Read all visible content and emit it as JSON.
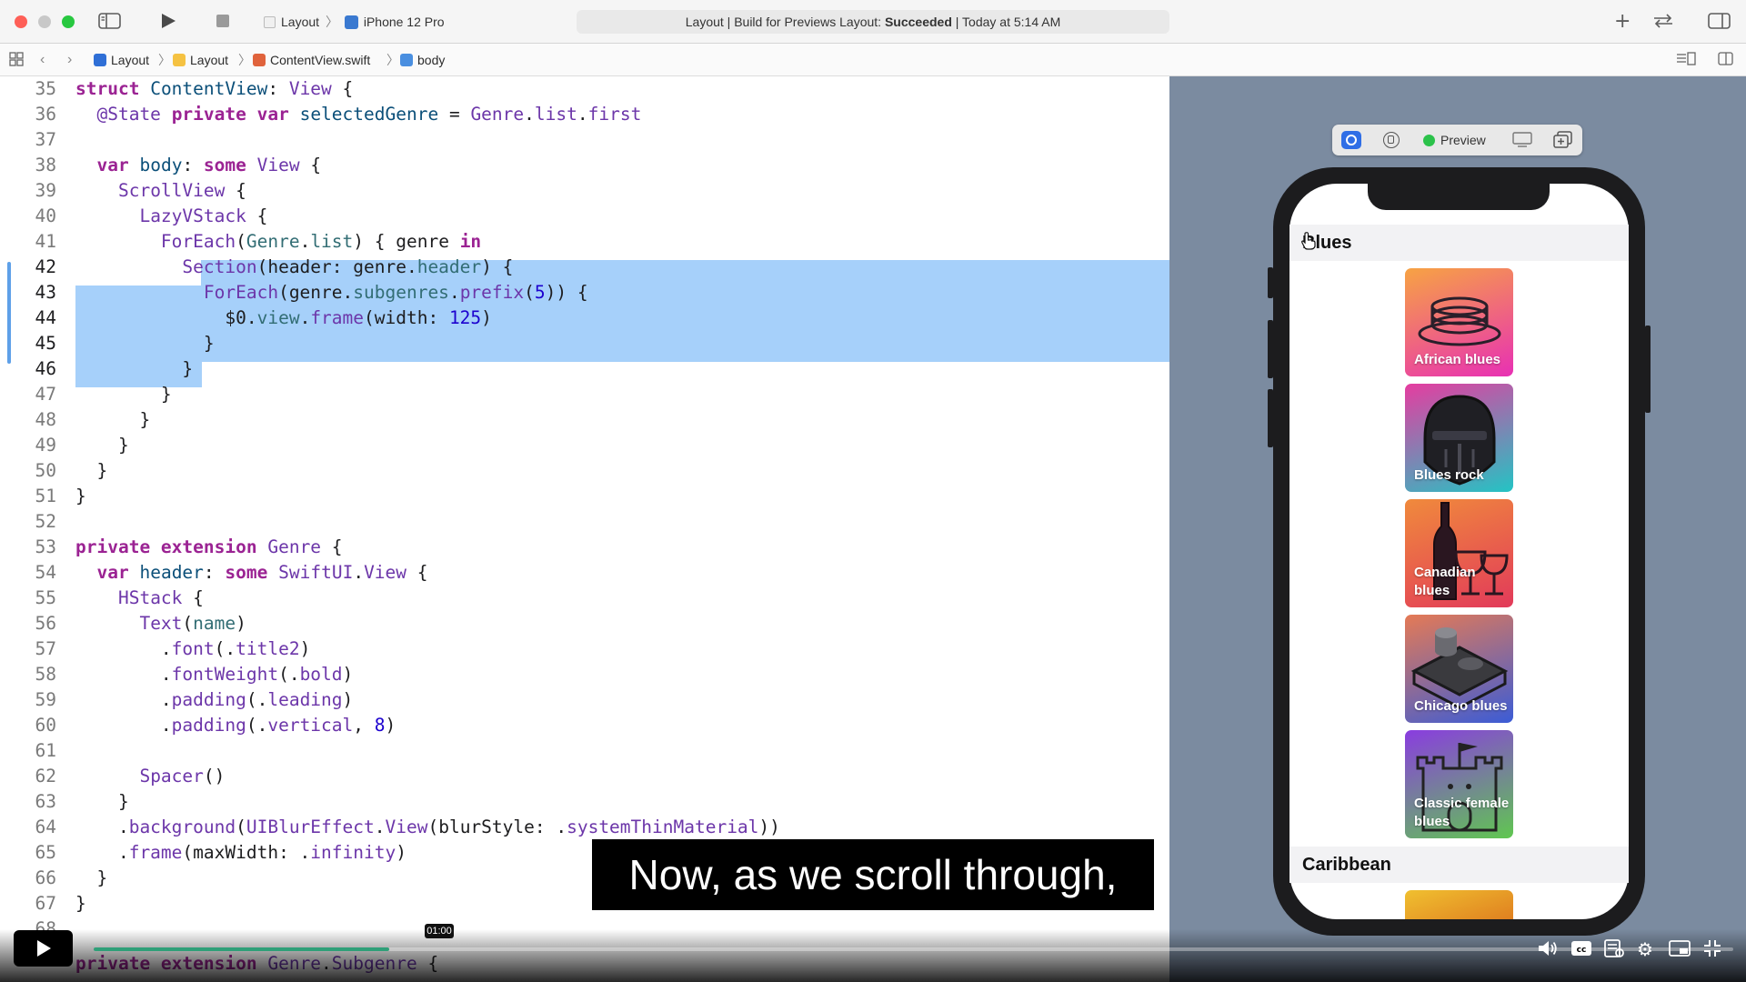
{
  "toolbar": {
    "scheme_project": "Layout",
    "scheme_device": "iPhone 12 Pro",
    "status_prefix": "Layout | Build for Previews Layout: ",
    "status_result": "Succeeded",
    "status_suffix": " | Today at 5:14 AM"
  },
  "jumpbar": {
    "items": [
      "Layout",
      "Layout",
      "ContentView.swift",
      "body"
    ]
  },
  "editor": {
    "line_numbers": [
      "35",
      "36",
      "37",
      "38",
      "39",
      "40",
      "41",
      "42",
      "43",
      "44",
      "45",
      "46",
      "47",
      "48",
      "49",
      "50",
      "51",
      "52",
      "53",
      "54",
      "55",
      "56",
      "57",
      "58",
      "59",
      "60",
      "61",
      "62",
      "63",
      "64",
      "65",
      "66",
      "67",
      "68"
    ]
  },
  "preview": {
    "toolbar_label": "Preview",
    "sections": [
      {
        "header": "Blues",
        "tiles": [
          {
            "label": "African blues",
            "gradient": [
              "#f7a343",
              "#e830b4"
            ]
          },
          {
            "label": "Blues rock",
            "gradient": [
              "#e63ca0",
              "#23c4c4"
            ]
          },
          {
            "label": "Canadian blues",
            "gradient": [
              "#f08a3c",
              "#e23a5a"
            ]
          },
          {
            "label": "Chicago blues",
            "gradient": [
              "#e57a55",
              "#3b5cd6"
            ]
          },
          {
            "label": "Classic female blues",
            "gradient": [
              "#8a3ce0",
              "#60c750"
            ]
          }
        ]
      },
      {
        "header": "Caribbean",
        "tiles": [
          {
            "label": "",
            "gradient": [
              "#f0c030",
              "#e08020"
            ]
          }
        ]
      }
    ]
  },
  "video": {
    "subtitle": "Now, as we scroll through,",
    "timecode": "01:00",
    "progress_fraction": 0.18
  },
  "colors": {
    "selection": "#a6d0fa",
    "canvas_bg": "#7b8ba0",
    "progress": "#2f9f78"
  }
}
